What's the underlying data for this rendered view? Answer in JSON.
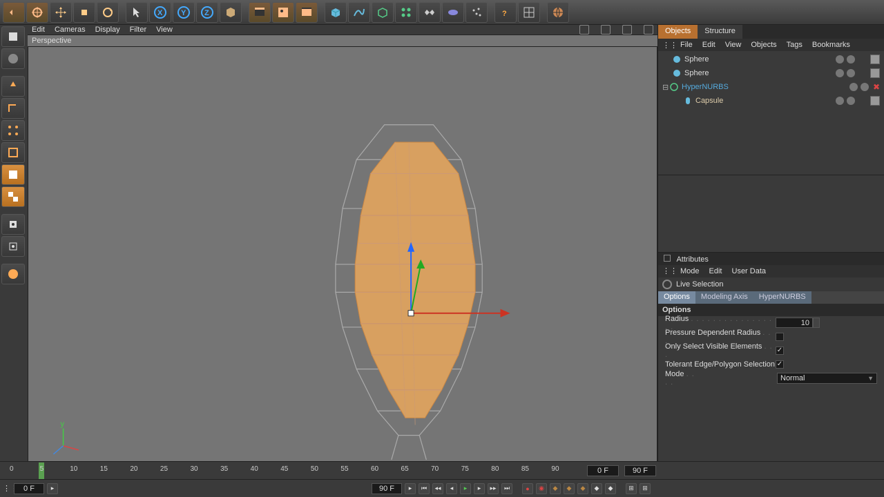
{
  "toolbar_icons": [
    "undo",
    "live-select",
    "move",
    "scale",
    "rotate",
    "select",
    "x-axis",
    "y-axis",
    "z-axis",
    "cube",
    "render",
    "picture-view",
    "render-settings",
    "primitive",
    "spline",
    "nurbs",
    "array",
    "deformer",
    "light",
    "tag",
    "help",
    "layout",
    "content-browser"
  ],
  "viewport": {
    "menu": [
      "Edit",
      "Cameras",
      "Display",
      "Filter",
      "View"
    ],
    "label": "Perspective"
  },
  "tabs": {
    "objects": "Objects",
    "structure": "Structure"
  },
  "obj_menu": [
    "File",
    "Edit",
    "View",
    "Objects",
    "Tags",
    "Bookmarks"
  ],
  "tree": [
    {
      "name": "Sphere",
      "indent": 14,
      "icon": "sphere",
      "cls": "",
      "dots": true
    },
    {
      "name": "Sphere",
      "indent": 14,
      "icon": "sphere",
      "cls": "",
      "dots": true
    },
    {
      "name": "HyperNURBS",
      "indent": 14,
      "icon": "nurbs",
      "cls": "cyan",
      "x": true,
      "exp": true
    },
    {
      "name": "Capsule",
      "indent": 30,
      "icon": "capsule",
      "cls": "yellow",
      "dots": true
    }
  ],
  "attr": {
    "title": "Attributes",
    "menu": [
      "Mode",
      "Edit",
      "User Data"
    ],
    "tool": "Live Selection",
    "tabs": [
      "Options",
      "Modeling Axis",
      "HyperNURBS"
    ],
    "section": "Options"
  },
  "opts": {
    "radius_lbl": "Radius",
    "radius_val": "10",
    "pressure_lbl": "Pressure Dependent Radius",
    "visible_lbl": "Only Select Visible Elements",
    "tolerant_lbl": "Tolerant Edge/Polygon Selection",
    "mode_lbl": "Mode",
    "mode_val": "Normal"
  },
  "timeline": {
    "ticks": [
      "0",
      "5",
      "10",
      "15",
      "20",
      "25",
      "30",
      "35",
      "40",
      "45",
      "50",
      "55",
      "60",
      "65",
      "70",
      "75",
      "80",
      "85",
      "90"
    ],
    "start": "0 F",
    "end": "90 F",
    "curA": "0 F",
    "curB": "90 F"
  }
}
